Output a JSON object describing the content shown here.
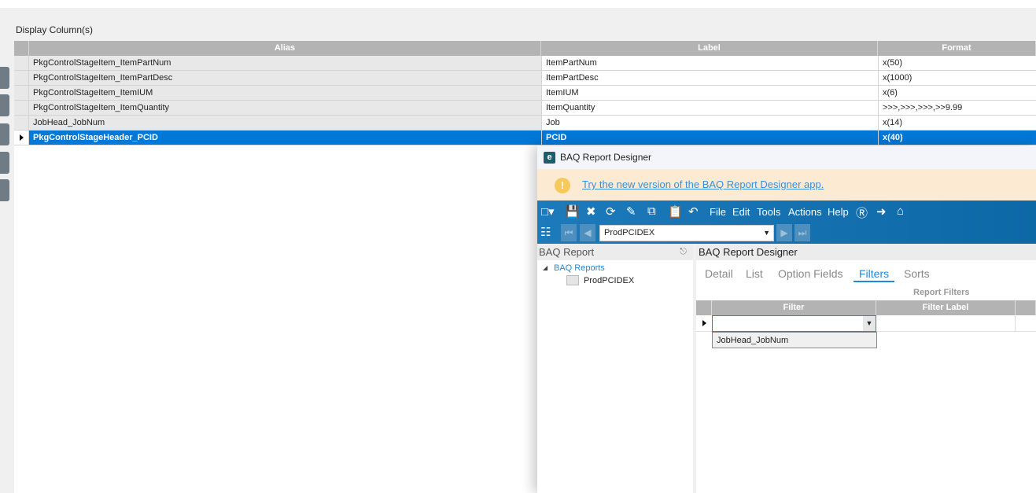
{
  "display_columns": {
    "title": "Display Column(s)",
    "headers": [
      "Alias",
      "Label",
      "Format"
    ],
    "rows": [
      {
        "alias": "PkgControlStageItem_ItemPartNum",
        "label": "ItemPartNum",
        "format": "x(50)"
      },
      {
        "alias": "PkgControlStageItem_ItemPartDesc",
        "label": "ItemPartDesc",
        "format": "x(1000)"
      },
      {
        "alias": "PkgControlStageItem_ItemIUM",
        "label": "ItemIUM",
        "format": "x(6)"
      },
      {
        "alias": "PkgControlStageItem_ItemQuantity",
        "label": "ItemQuantity",
        "format": ">>>,>>>,>>>,>>9.99"
      },
      {
        "alias": "JobHead_JobNum",
        "label": "Job",
        "format": "x(14)"
      },
      {
        "alias": "PkgControlStageHeader_PCID",
        "label": "PCID",
        "format": "x(40)"
      }
    ],
    "selected_row": 5
  },
  "window": {
    "title": "BAQ Report Designer",
    "logo": "e",
    "banner_link": "Try the new version of the BAQ Report Designer app.",
    "menu": [
      "File",
      "Edit",
      "Tools",
      "Actions",
      "Help"
    ],
    "record_combo": "ProdPCIDEX",
    "left_panel": {
      "title": "BAQ Report",
      "tree_root": "BAQ Reports",
      "tree_child": "ProdPCIDEX"
    },
    "main_panel": {
      "title": "BAQ Report Designer",
      "tabs": [
        "Detail",
        "List",
        "Option Fields",
        "Filters",
        "Sorts"
      ],
      "active_tab": "Filters",
      "section": "Report Filters",
      "headers": [
        "Filter",
        "Filter Label"
      ],
      "dropdown_option": "JobHead_JobNum"
    }
  },
  "colors": {
    "selected": "#0078d7",
    "toolbar": "#1372b2",
    "banner": "#fcebd2"
  }
}
